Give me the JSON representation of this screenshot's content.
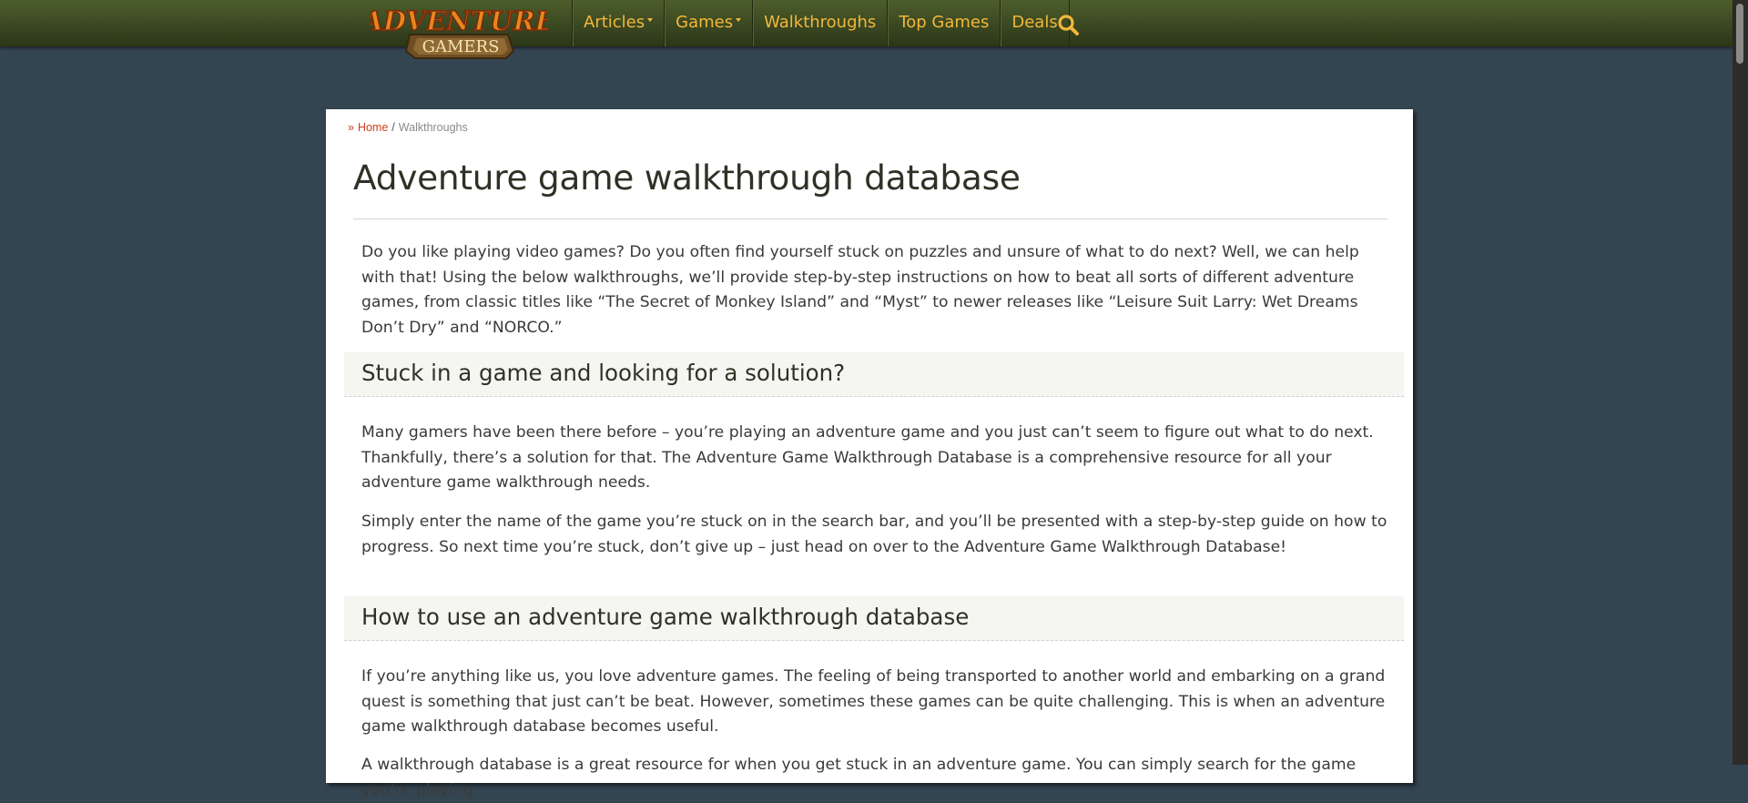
{
  "header": {
    "logo_text_top": "ADVENTURE",
    "logo_text_bottom": "GAMERS",
    "nav": [
      {
        "label": "Articles",
        "dropdown": true
      },
      {
        "label": "Games",
        "dropdown": true
      },
      {
        "label": "Walkthroughs",
        "dropdown": false
      },
      {
        "label": "Top Games",
        "dropdown": false
      },
      {
        "label": "Deals",
        "dropdown": false
      }
    ],
    "search_icon": "search-icon"
  },
  "breadcrumb": {
    "home": "Home",
    "separator": "/",
    "current": "Walkthroughs"
  },
  "page": {
    "title": "Adventure game walkthrough database",
    "intro": "Do you like playing video games? Do you often find yourself stuck on puzzles and unsure of what to do next? Well, we can help with that! Using the below walkthroughs, we’ll provide step-by-step instructions on how to beat all sorts of different adventure games, from classic titles like “The Secret of Monkey Island” and “Myst” to newer releases like “Leisure Suit Larry: Wet Dreams Don’t Dry” and “NORCO.”",
    "sections": [
      {
        "heading": "Stuck in a game and looking for a solution?",
        "paragraphs": [
          "Many gamers have been there before – you’re playing an adventure game and you just can’t seem to figure out what to do next. Thankfully, there’s a solution for that. The Adventure Game Walkthrough Database is a comprehensive resource for all your adventure game walkthrough needs.",
          "Simply enter the name of the game you’re stuck on in the search bar, and you’ll be presented with a step-by-step guide on how to progress. So next time you’re stuck, don’t give up – just head on over to the Adventure Game Walkthrough Database!"
        ]
      },
      {
        "heading": "How to use an adventure game walkthrough database",
        "paragraphs": [
          "If you’re anything like us, you love adventure games. The feeling of being transported to another world and embarking on a grand quest is something that just can’t be beat. However, sometimes these games can be quite challenging. This is when an adventure game walkthrough database becomes useful.",
          "A walkthrough database is a great resource for when you get stuck in an adventure game. You can simply search for the game you’re playing"
        ]
      }
    ]
  },
  "colors": {
    "background": "#344552",
    "nav_text": "#f3b73a",
    "link": "#c9401c",
    "heading": "#2e3225"
  }
}
